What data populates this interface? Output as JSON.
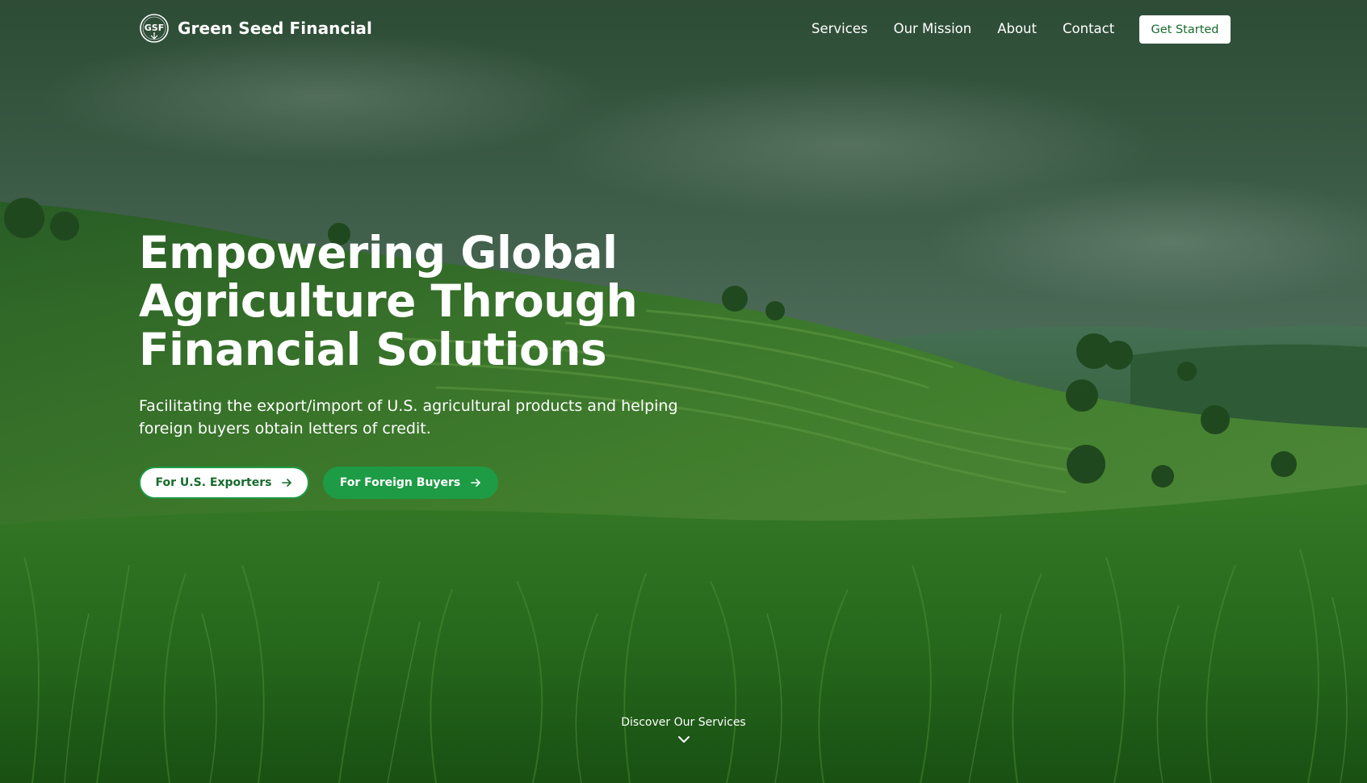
{
  "nav": {
    "brand": "Green Seed Financial",
    "logo_icon": "gsf-logo-icon",
    "links": [
      "Services",
      "Our Mission",
      "About",
      "Contact"
    ],
    "cta": "Get Started"
  },
  "hero": {
    "title_lines": [
      "Empowering Global",
      "Agriculture Through",
      "Financial Solutions"
    ],
    "subtitle_lines": [
      "Facilitating the export/import of U.S. agricultural products and helping",
      "foreign buyers obtain letters of credit."
    ],
    "buttons": {
      "exporters": "For U.S. Exporters",
      "buyers": "For Foreign Buyers"
    },
    "discover": "Discover Our Services"
  },
  "colors": {
    "accent_green": "#1e9b45",
    "dark_green_text": "#176b2d",
    "white": "#ffffff"
  }
}
